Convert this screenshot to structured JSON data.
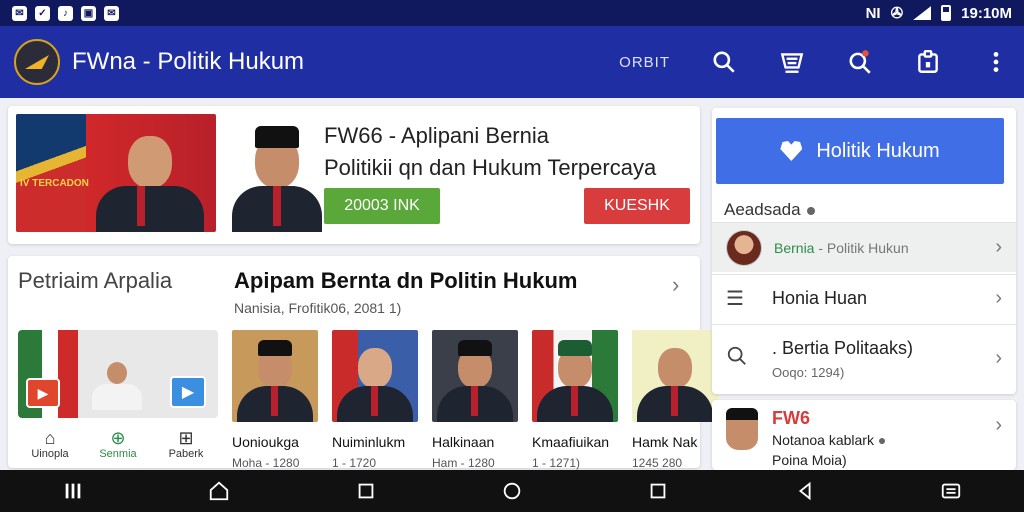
{
  "status_bar": {
    "time": "19:10M",
    "network": "NI"
  },
  "app_bar": {
    "title": "FWna - Politik Hukum",
    "label": "ORBIT",
    "colors": {
      "bar": "#1f2fa3",
      "status": "#10195e"
    }
  },
  "banner": {
    "image_caption": "IV TERCADON",
    "title_line1": "FW66 - Aplipani Bernia",
    "title_line2": "Politikii qn dan Hukum Terpercaya",
    "green_button": "20003 INK",
    "red_button": "KUESHK"
  },
  "content": {
    "section_label": "Petriaim Arpalia",
    "title": "Apipam Bernta dn Politin Hukum",
    "subtitle": "Nanisia, Frofitik06, 2081 1)",
    "mini_nav": [
      {
        "icon": "home-icon",
        "label": "Uinopla"
      },
      {
        "icon": "bag-icon",
        "label": "Senmia"
      },
      {
        "icon": "grid-icon",
        "label": "Paberk"
      }
    ],
    "thumbs": [
      {
        "name": "Uonioukga",
        "meta": "Moha - 1280"
      },
      {
        "name": "Nuiminlukm",
        "meta": "1 - 1720"
      },
      {
        "name": "Halkinaan",
        "meta": "Ham - 1280"
      },
      {
        "name": "Kmaafiuikan",
        "meta": "1 - 1271)"
      },
      {
        "name": "Hamk Nak",
        "meta": "1245 280"
      }
    ]
  },
  "right_panel": {
    "primary_button": "Holitik Hukum",
    "section_label": "Aeadsada",
    "row1": {
      "accent": "Bernia",
      "rest": " - Politik Hukun"
    },
    "row2": "Honia Huan",
    "row3": {
      "title": ". Bertia Politaaks)",
      "sub": "Ooqo: 1294)"
    },
    "card2": {
      "title": "FW6",
      "line1": "Notanoa kablark",
      "line2": "Poina Moia)"
    }
  }
}
